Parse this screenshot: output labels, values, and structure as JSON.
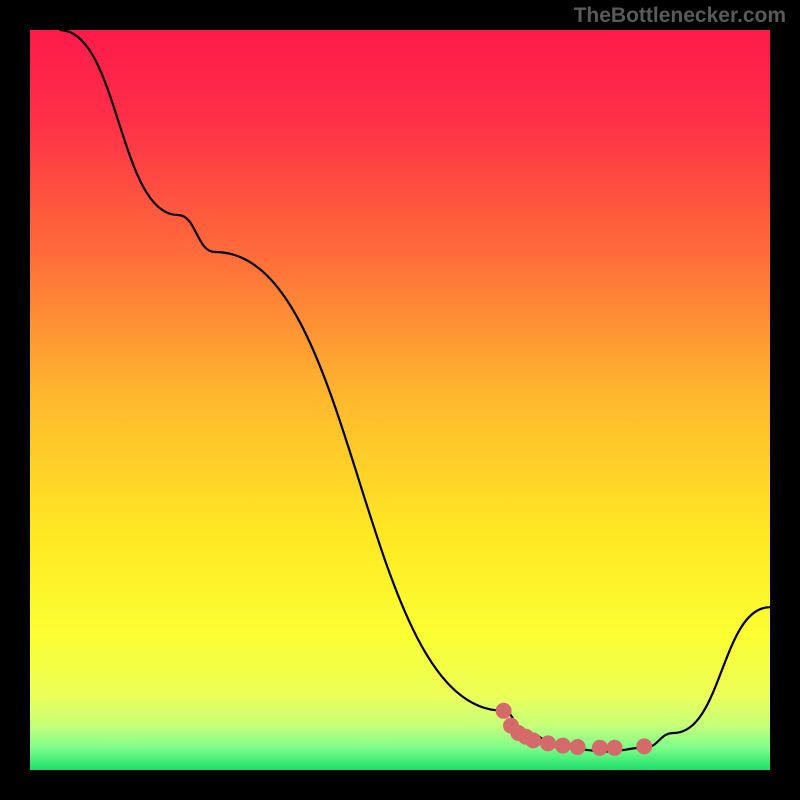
{
  "watermark": "TheBottlenecker.com",
  "chart_data": {
    "type": "line",
    "title": "",
    "xlabel": "",
    "ylabel": "",
    "xlim": [
      0,
      100
    ],
    "ylim": [
      0,
      100
    ],
    "background_gradient": {
      "stops": [
        {
          "offset": 0,
          "color": "#ff1a4a"
        },
        {
          "offset": 0.12,
          "color": "#ff2f48"
        },
        {
          "offset": 0.3,
          "color": "#ff6b3a"
        },
        {
          "offset": 0.5,
          "color": "#ffb92e"
        },
        {
          "offset": 0.68,
          "color": "#ffe824"
        },
        {
          "offset": 0.82,
          "color": "#fbff33"
        },
        {
          "offset": 0.9,
          "color": "#ecff5a"
        },
        {
          "offset": 0.94,
          "color": "#c6ff7a"
        },
        {
          "offset": 0.97,
          "color": "#7dff8a"
        },
        {
          "offset": 1.0,
          "color": "#1bdf6a"
        }
      ]
    },
    "series": [
      {
        "name": "bottleneck-curve",
        "type": "line",
        "color": "#000000",
        "points": [
          {
            "x": 4,
            "y": 100
          },
          {
            "x": 20,
            "y": 75
          },
          {
            "x": 25,
            "y": 70
          },
          {
            "x": 64,
            "y": 8
          },
          {
            "x": 67,
            "y": 5
          },
          {
            "x": 72,
            "y": 3
          },
          {
            "x": 78,
            "y": 2.5
          },
          {
            "x": 83,
            "y": 3
          },
          {
            "x": 87,
            "y": 5
          },
          {
            "x": 100,
            "y": 22
          }
        ]
      },
      {
        "name": "marker-region",
        "type": "markers",
        "color": "#d46a6a",
        "points": [
          {
            "x": 64,
            "y": 8
          },
          {
            "x": 65,
            "y": 6
          },
          {
            "x": 66,
            "y": 5
          },
          {
            "x": 67,
            "y": 4.5
          },
          {
            "x": 68,
            "y": 4
          },
          {
            "x": 70,
            "y": 3.6
          },
          {
            "x": 72,
            "y": 3.3
          },
          {
            "x": 74,
            "y": 3.1
          },
          {
            "x": 77,
            "y": 3.0
          },
          {
            "x": 79,
            "y": 3.0
          },
          {
            "x": 83,
            "y": 3.2
          }
        ]
      }
    ]
  }
}
